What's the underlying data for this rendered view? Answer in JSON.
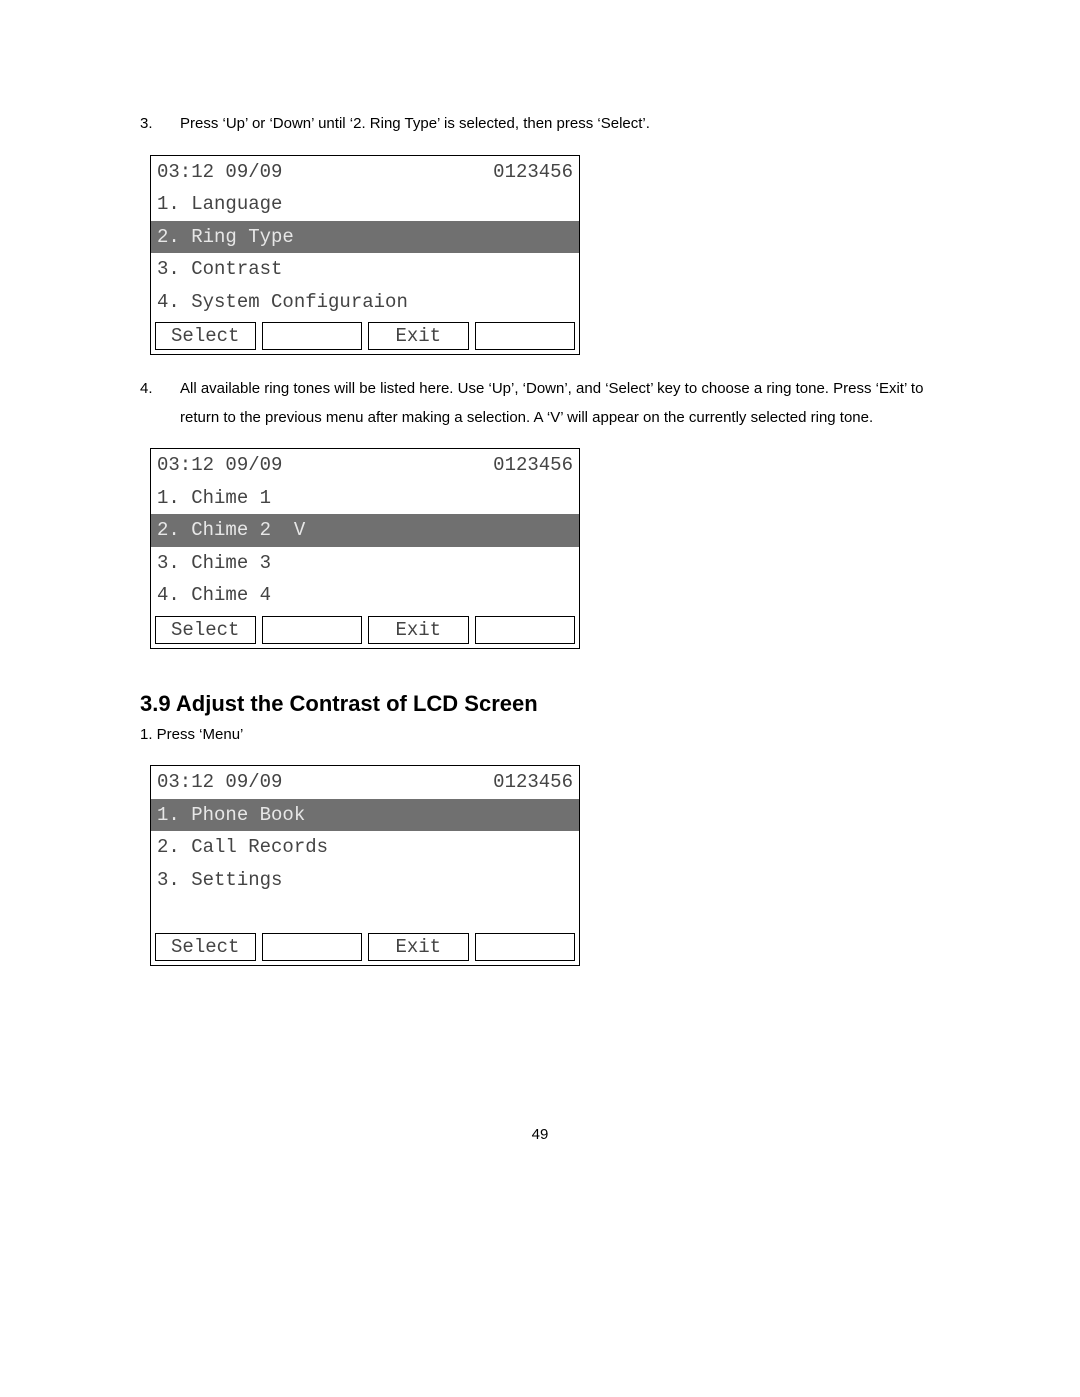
{
  "steps": {
    "s3_num": "3.",
    "s3_text": "Press ‘Up’ or ‘Down’ until ‘2. Ring Type’ is selected, then press ‘Select’.",
    "s4_num": "4.",
    "s4_text": "All available ring tones will be listed here.    Use ‘Up’, ‘Down’, and ‘Select’ key to choose a ring tone.    Press    ‘Exit’ to return to the previous menu after making a selection.    A ‘V’ will appear on the currently selected ring tone.",
    "s1b_text": "1. Press ‘Menu’"
  },
  "heading": "3.9 Adjust the Contrast of LCD Screen",
  "common": {
    "time": "03:12 09/09",
    "id": "0123456",
    "select": "Select",
    "exit": "Exit",
    "blank": ""
  },
  "screen1": {
    "l1": "1. Language",
    "l2": "2. Ring Type",
    "l3": "3. Contrast",
    "l4": "4. System Configuraion"
  },
  "screen2": {
    "l1": "1. Chime 1",
    "l2": "2. Chime 2  V",
    "l3": "3. Chime 3",
    "l4": "4. Chime 4"
  },
  "screen3": {
    "l1": "1. Phone Book",
    "l2": "2. Call Records",
    "l3": "3. Settings",
    "l4": " "
  },
  "page_number": "49"
}
